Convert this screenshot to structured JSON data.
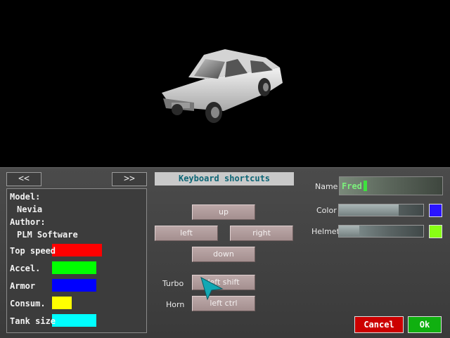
{
  "nav": {
    "prev_label": "<<",
    "next_label": ">>"
  },
  "car": {
    "model_label": "Model:",
    "model": "Nevia",
    "author_label": "Author:",
    "author": "PLM Software",
    "stats": [
      {
        "label": "Top speed",
        "value": 0.57,
        "color": "#ff0000"
      },
      {
        "label": "Accel.",
        "value": 0.5,
        "color": "#00ff00"
      },
      {
        "label": "Armor",
        "value": 0.5,
        "color": "#0000ff"
      },
      {
        "label": "Consum.",
        "value": 0.22,
        "color": "#ffff00"
      },
      {
        "label": "Tank size",
        "value": 0.5,
        "color": "#00ffff"
      }
    ]
  },
  "keyboard": {
    "title": "Keyboard shortcuts",
    "up": "up",
    "left": "left",
    "right": "right",
    "down": "down",
    "turbo_label": "Turbo",
    "turbo_key": "left shift",
    "horn_label": "Horn",
    "horn_key": "left ctrl"
  },
  "player": {
    "name_label": "Name",
    "name_value": "Fred",
    "color_label": "Color",
    "color_level": 0.71,
    "color_swatch": "#2a14ff",
    "helmet_label": "Helmet",
    "helmet_level": 0.24,
    "helmet_swatch": "#88ff14"
  },
  "actions": {
    "cancel_label": "Cancel",
    "ok_label": "Ok",
    "cancel_color": "#cc0000",
    "ok_color": "#10b010"
  }
}
